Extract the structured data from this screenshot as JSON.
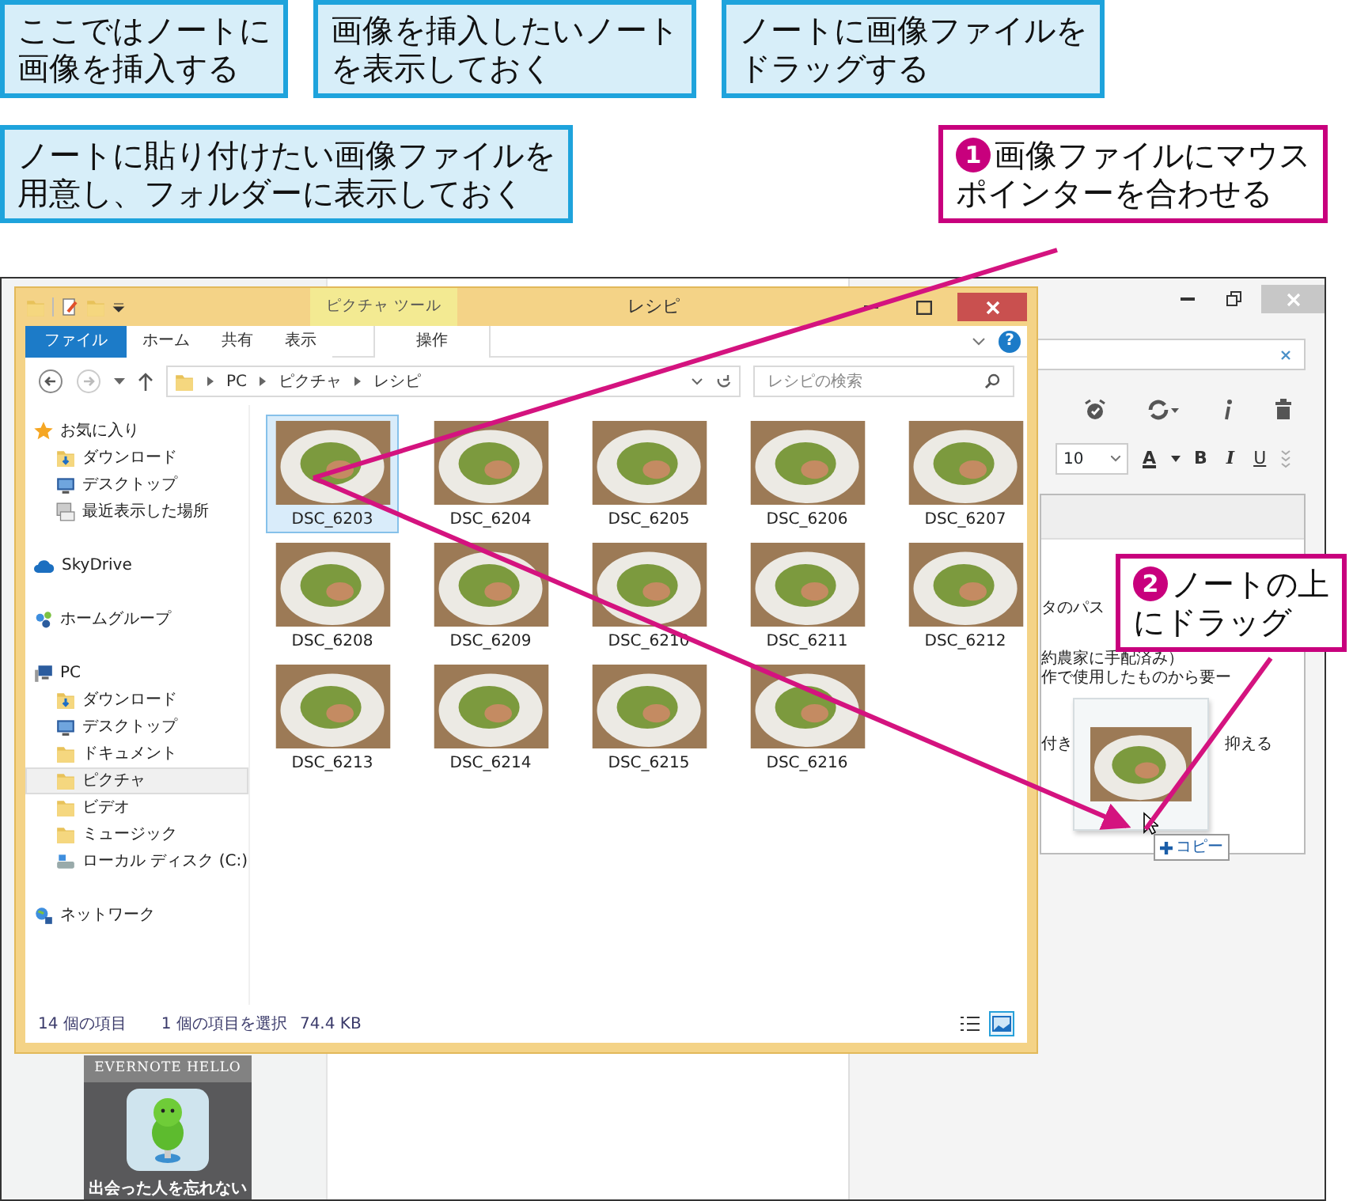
{
  "callouts": [
    {
      "lines": [
        "ここではノートに",
        "画像を挿入する"
      ]
    },
    {
      "lines": [
        "画像を挿入したいノート",
        "を表示しておく"
      ]
    },
    {
      "lines": [
        "ノートに画像ファイルを",
        "ドラッグする"
      ]
    },
    {
      "lines": [
        "ノートに貼り付けたい画像ファイルを",
        "用意し、フォルダーに表示しておく"
      ]
    }
  ],
  "steps": [
    {
      "number": "1",
      "lines": [
        "画像ファイルにマウス",
        "ポインターを合わせる"
      ]
    },
    {
      "number": "2",
      "lines": [
        "ノートの上",
        "にドラッグ"
      ]
    }
  ],
  "explorer": {
    "title": "レシピ",
    "context_label": "ピクチャ ツール",
    "ribbon_tabs": [
      {
        "label": "ファイル",
        "kind": "file",
        "selected": false
      },
      {
        "label": "ホーム",
        "kind": "tab",
        "selected": false
      },
      {
        "label": "共有",
        "kind": "tab",
        "selected": false
      },
      {
        "label": "表示",
        "kind": "tab",
        "selected": false
      },
      {
        "label": "操作",
        "kind": "context",
        "selected": false
      }
    ],
    "help": "?",
    "path": [
      "PC",
      "ピクチャ",
      "レシピ"
    ],
    "search": {
      "placeholder": "レシピの検索"
    },
    "nav": [
      {
        "label": "お気に入り",
        "kind": "star",
        "selected": false,
        "children": [
          {
            "label": "ダウンロード",
            "kind": "download",
            "selected": false
          },
          {
            "label": "デスクトップ",
            "kind": "desktop",
            "selected": false
          },
          {
            "label": "最近表示した場所",
            "kind": "recent",
            "selected": false
          }
        ]
      },
      {
        "label": "SkyDrive",
        "kind": "cloud",
        "selected": false
      },
      {
        "label": "ホームグループ",
        "kind": "homegroup",
        "selected": false
      },
      {
        "label": "PC",
        "kind": "pc",
        "selected": false,
        "children": [
          {
            "label": "ダウンロード",
            "kind": "download",
            "selected": false
          },
          {
            "label": "デスクトップ",
            "kind": "desktop",
            "selected": false
          },
          {
            "label": "ドキュメント",
            "kind": "folder",
            "selected": false
          },
          {
            "label": "ピクチャ",
            "kind": "folder",
            "selected": true
          },
          {
            "label": "ビデオ",
            "kind": "folder",
            "selected": false
          },
          {
            "label": "ミュージック",
            "kind": "folder",
            "selected": false
          },
          {
            "label": "ローカル ディスク (C:)",
            "kind": "drive",
            "selected": false
          }
        ]
      },
      {
        "label": "ネットワーク",
        "kind": "network",
        "selected": false
      }
    ],
    "files": [
      {
        "name": "DSC_6203",
        "selected": true
      },
      {
        "name": "DSC_6204",
        "selected": false
      },
      {
        "name": "DSC_6205",
        "selected": false
      },
      {
        "name": "DSC_6206",
        "selected": false
      },
      {
        "name": "DSC_6207",
        "selected": false
      },
      {
        "name": "DSC_6208",
        "selected": false
      },
      {
        "name": "DSC_6209",
        "selected": false
      },
      {
        "name": "DSC_6210",
        "selected": false
      },
      {
        "name": "DSC_6211",
        "selected": false
      },
      {
        "name": "DSC_6212",
        "selected": false
      },
      {
        "name": "DSC_6213",
        "selected": false
      },
      {
        "name": "DSC_6214",
        "selected": false
      },
      {
        "name": "DSC_6215",
        "selected": false
      },
      {
        "name": "DSC_6216",
        "selected": false
      }
    ],
    "status": {
      "count": "14 個の項目",
      "selection": "1 個の項目を選択",
      "size": "74.4 KB"
    },
    "views": [
      {
        "kind": "details",
        "selected": false
      },
      {
        "kind": "thumbnails",
        "selected": true
      }
    ]
  },
  "evernote": {
    "font_size": "10",
    "format_buttons": [
      "A",
      "B",
      "I",
      "U"
    ],
    "note_lines": [
      [
        "タのパス"
      ],
      [
        "約農家に手配済み）"
      ],
      [
        "作で使用したものから要ー"
      ],
      [
        "付き",
        "抑える"
      ]
    ],
    "drag_tip": "コピー",
    "card": {
      "title": "EVERNOTE HELLO",
      "caption": "出会った人を忘れない"
    }
  }
}
